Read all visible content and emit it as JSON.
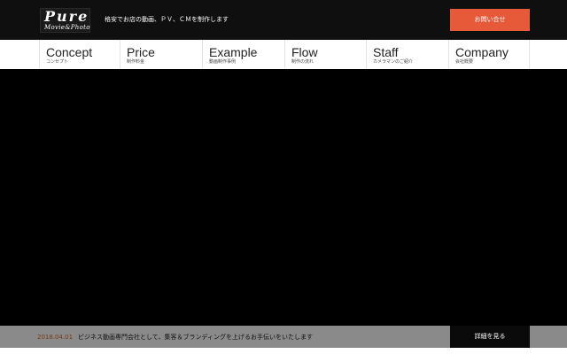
{
  "header": {
    "logo_main": "Pure",
    "logo_sub": "Movie&Photo",
    "tagline": "格安でお店の動画、ＰＶ、ＣＭを制作します",
    "contact_label": "お問い合せ"
  },
  "nav": {
    "items": [
      {
        "en": "Concept",
        "jp": "コンセプト"
      },
      {
        "en": "Price",
        "jp": "制作料金"
      },
      {
        "en": "Example",
        "jp": "動画制作事例"
      },
      {
        "en": "Flow",
        "jp": "制作の流れ"
      },
      {
        "en": "Staff",
        "jp": "カメラマンのご紹介"
      },
      {
        "en": "Company",
        "jp": "会社概要"
      }
    ]
  },
  "news": {
    "date": "2018.04.01",
    "text": "ビジネス動画専門会社として、集客＆ブランディングを上げるお手伝いをいたします",
    "button_label": "詳細を見る"
  },
  "colors": {
    "accent": "#e65a3a",
    "header_bg": "#0f0f0f",
    "news_bg": "#8a8a8a"
  }
}
